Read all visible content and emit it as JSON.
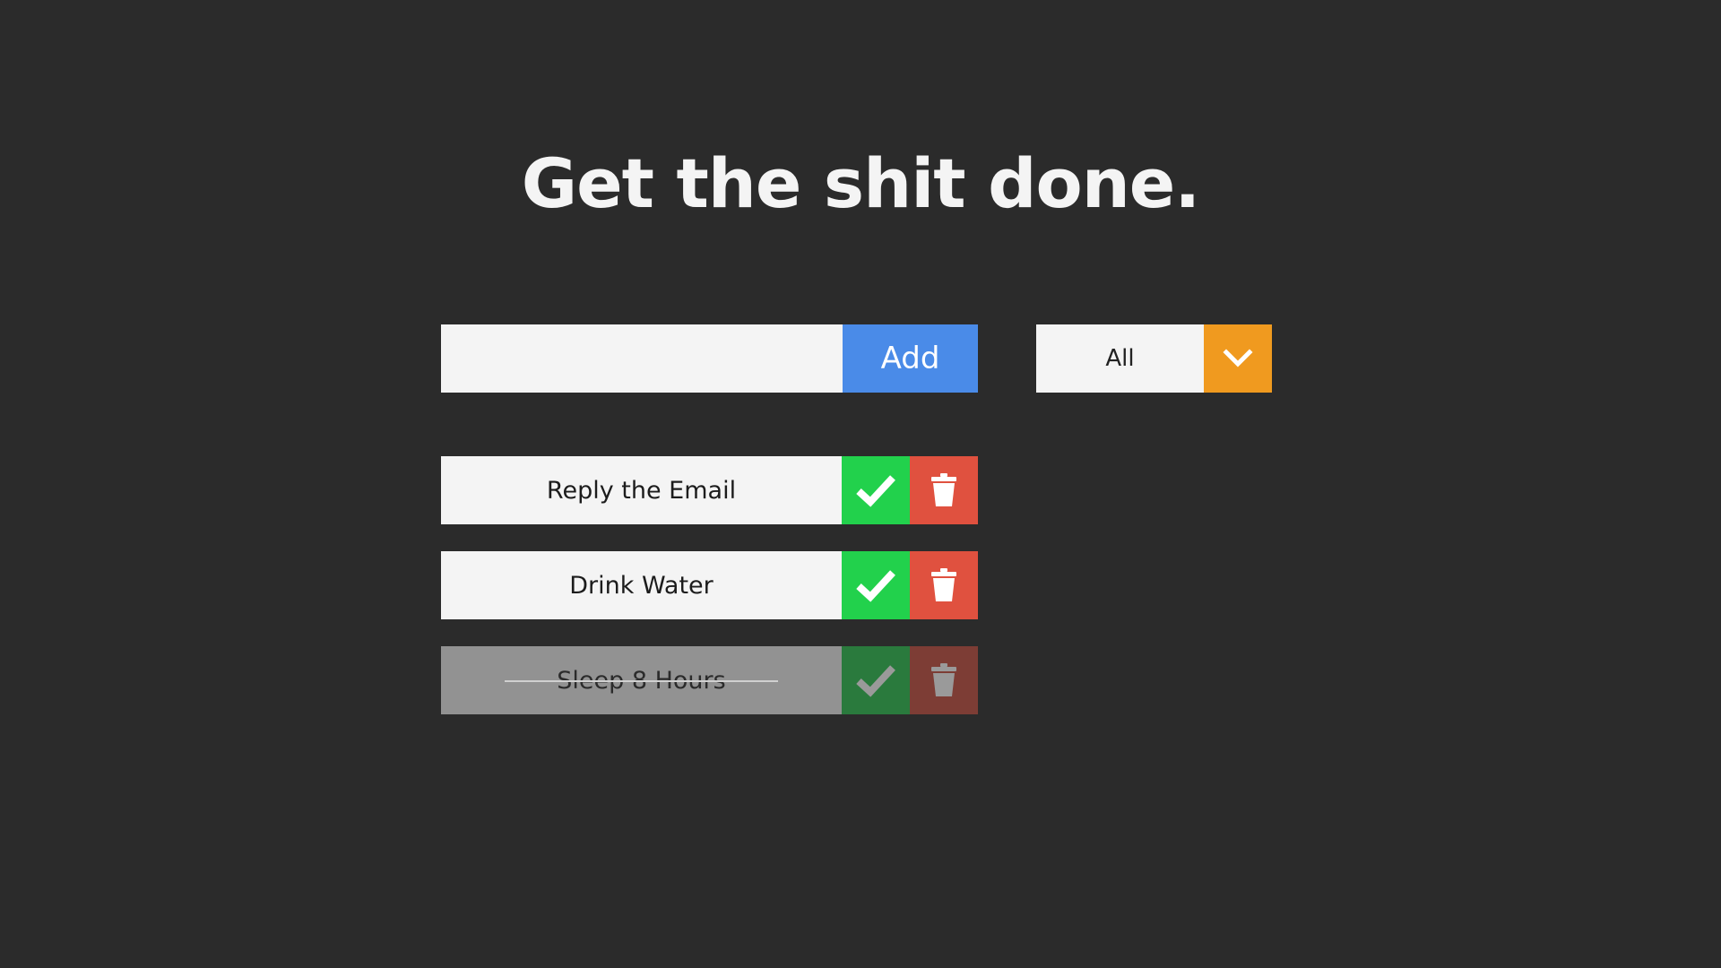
{
  "header": {
    "title": "Get the shit done."
  },
  "form": {
    "input_value": "",
    "input_placeholder": "",
    "add_label": "Add"
  },
  "filter": {
    "selected": "All",
    "icon": "chevron-down-icon",
    "accent_color": "#f09a1f"
  },
  "todos": [
    {
      "text": "Reply the Email",
      "completed": false
    },
    {
      "text": "Drink Water",
      "completed": false
    },
    {
      "text": "Sleep 8 Hours",
      "completed": true
    }
  ],
  "colors": {
    "background": "#2b2b2b",
    "add_button": "#4a8be8",
    "complete_button": "#22d14c",
    "trash_button": "#e0513f"
  }
}
